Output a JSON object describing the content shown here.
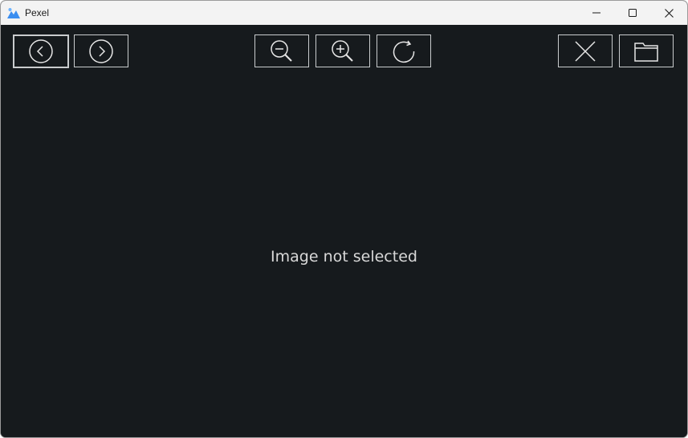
{
  "window": {
    "title": "Pexel",
    "app_icon": "mountain-image-icon",
    "controls": {
      "minimize": "minimize-icon",
      "maximize": "maximize-icon",
      "close": "close-icon"
    }
  },
  "toolbar": {
    "buttons": [
      {
        "id": "prev",
        "icon": "chevron-left-circle-icon"
      },
      {
        "id": "next",
        "icon": "chevron-right-circle-icon"
      },
      {
        "id": "zoom_out",
        "icon": "zoom-out-icon"
      },
      {
        "id": "zoom_in",
        "icon": "zoom-in-icon"
      },
      {
        "id": "rotate",
        "icon": "rotate-icon"
      },
      {
        "id": "close",
        "icon": "close-icon"
      },
      {
        "id": "open",
        "icon": "folder-icon"
      }
    ]
  },
  "viewer": {
    "placeholder": "Image not selected"
  },
  "colors": {
    "background": "#161a1d",
    "titlebar": "#f3f3f3",
    "button_border": "#c9ccce",
    "text": "#d8d8d8",
    "icon_blue": "#3b8ef0"
  }
}
